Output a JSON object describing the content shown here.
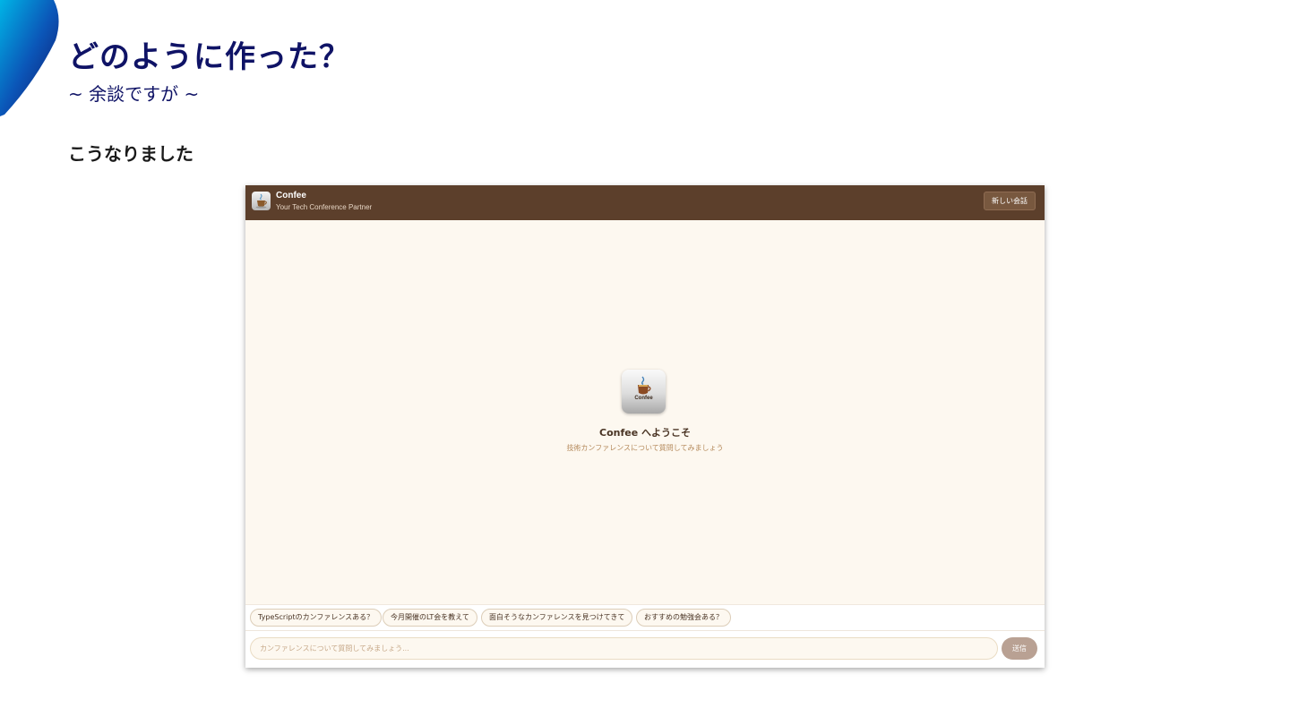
{
  "slide": {
    "title": "どのように作った？",
    "subtitle": "~ 余談ですが ~",
    "heading": "こうなりました",
    "accent_color": "#0f1366"
  },
  "app": {
    "name": "Confee",
    "tagline": "Your Tech Conference Partner",
    "header_color": "#5c3f2b",
    "new_chat_label": "新しい会話",
    "welcome": {
      "logo_text": "Confee",
      "title": "Confee へようこそ",
      "subtitle": "技術カンファレンスについて質問してみましょう"
    },
    "suggestions": [
      "TypeScriptのカンファレンスある？",
      "今月開催のLT会を教えて",
      "面白そうなカンファレンスを見つけてきて",
      "おすすめの勉強会ある？"
    ],
    "input": {
      "placeholder": "カンファレンスについて質問してみましょう...",
      "value": ""
    },
    "send_label": "送信"
  }
}
